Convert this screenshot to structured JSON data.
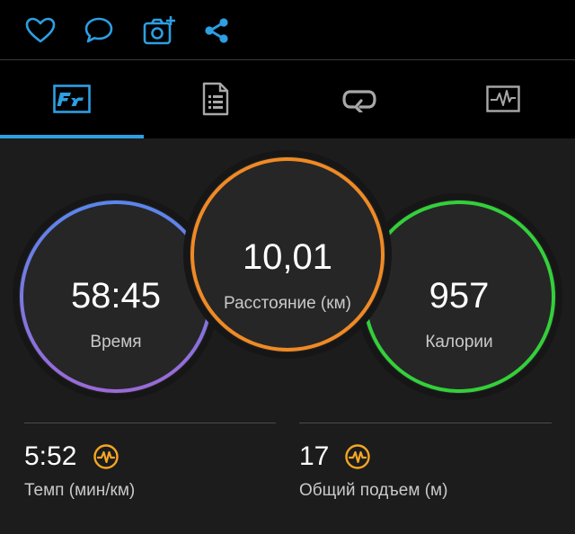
{
  "colors": {
    "accent": "#2d9fe3",
    "time_ring": "#6a7ce8",
    "distance_ring": "#f08a24",
    "calories_ring": "#33d03a",
    "zone_icon": "#f5a623"
  },
  "actions": [
    {
      "icon": "heart-icon"
    },
    {
      "icon": "comment-icon"
    },
    {
      "icon": "add-photo-icon"
    },
    {
      "icon": "share-icon"
    }
  ],
  "tabs": [
    {
      "icon": "overview-icon",
      "active": true
    },
    {
      "icon": "details-list-icon",
      "active": false
    },
    {
      "icon": "laps-icon",
      "active": false
    },
    {
      "icon": "charts-icon",
      "active": false
    }
  ],
  "summary": {
    "time": {
      "value": "58:45",
      "label": "Время"
    },
    "distance": {
      "value": "10,01",
      "label": "Расстояние (км)"
    },
    "calories": {
      "value": "957",
      "label": "Калории"
    }
  },
  "stats": {
    "pace": {
      "value": "5:52",
      "label": "Темп (мин/км)",
      "icon": "zone-chart-icon"
    },
    "ascent": {
      "value": "17",
      "label": "Общий подъем (м)",
      "icon": "zone-chart-icon"
    }
  }
}
